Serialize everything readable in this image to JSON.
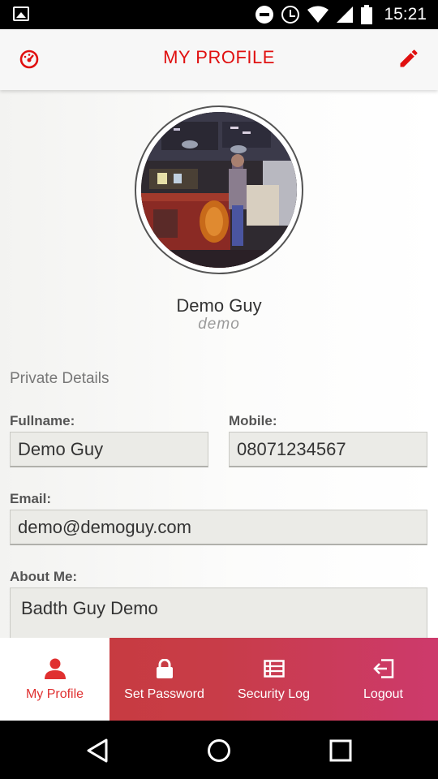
{
  "status_bar": {
    "time": "15:21"
  },
  "app_bar": {
    "title": "MY PROFILE"
  },
  "profile": {
    "name": "Demo Guy",
    "username": "demo"
  },
  "private_details": {
    "heading": "Private Details",
    "fullname_label": "Fullname:",
    "fullname_value": "Demo Guy",
    "mobile_label": "Mobile:",
    "mobile_value": "08071234567",
    "email_label": "Email:",
    "email_value": "demo@demoguy.com",
    "about_label": "About Me:",
    "about_value": "Badth Guy Demo"
  },
  "bottom_nav": {
    "items": [
      {
        "label": "My Profile",
        "icon": "person-icon",
        "active": true
      },
      {
        "label": "Set Password",
        "icon": "lock-icon",
        "active": false
      },
      {
        "label": "Security Log",
        "icon": "list-icon",
        "active": false
      },
      {
        "label": "Logout",
        "icon": "logout-icon",
        "active": false
      }
    ]
  },
  "colors": {
    "accent": "#e01010",
    "nav_start": "#c63a3a",
    "nav_end": "#cd3a6c"
  }
}
